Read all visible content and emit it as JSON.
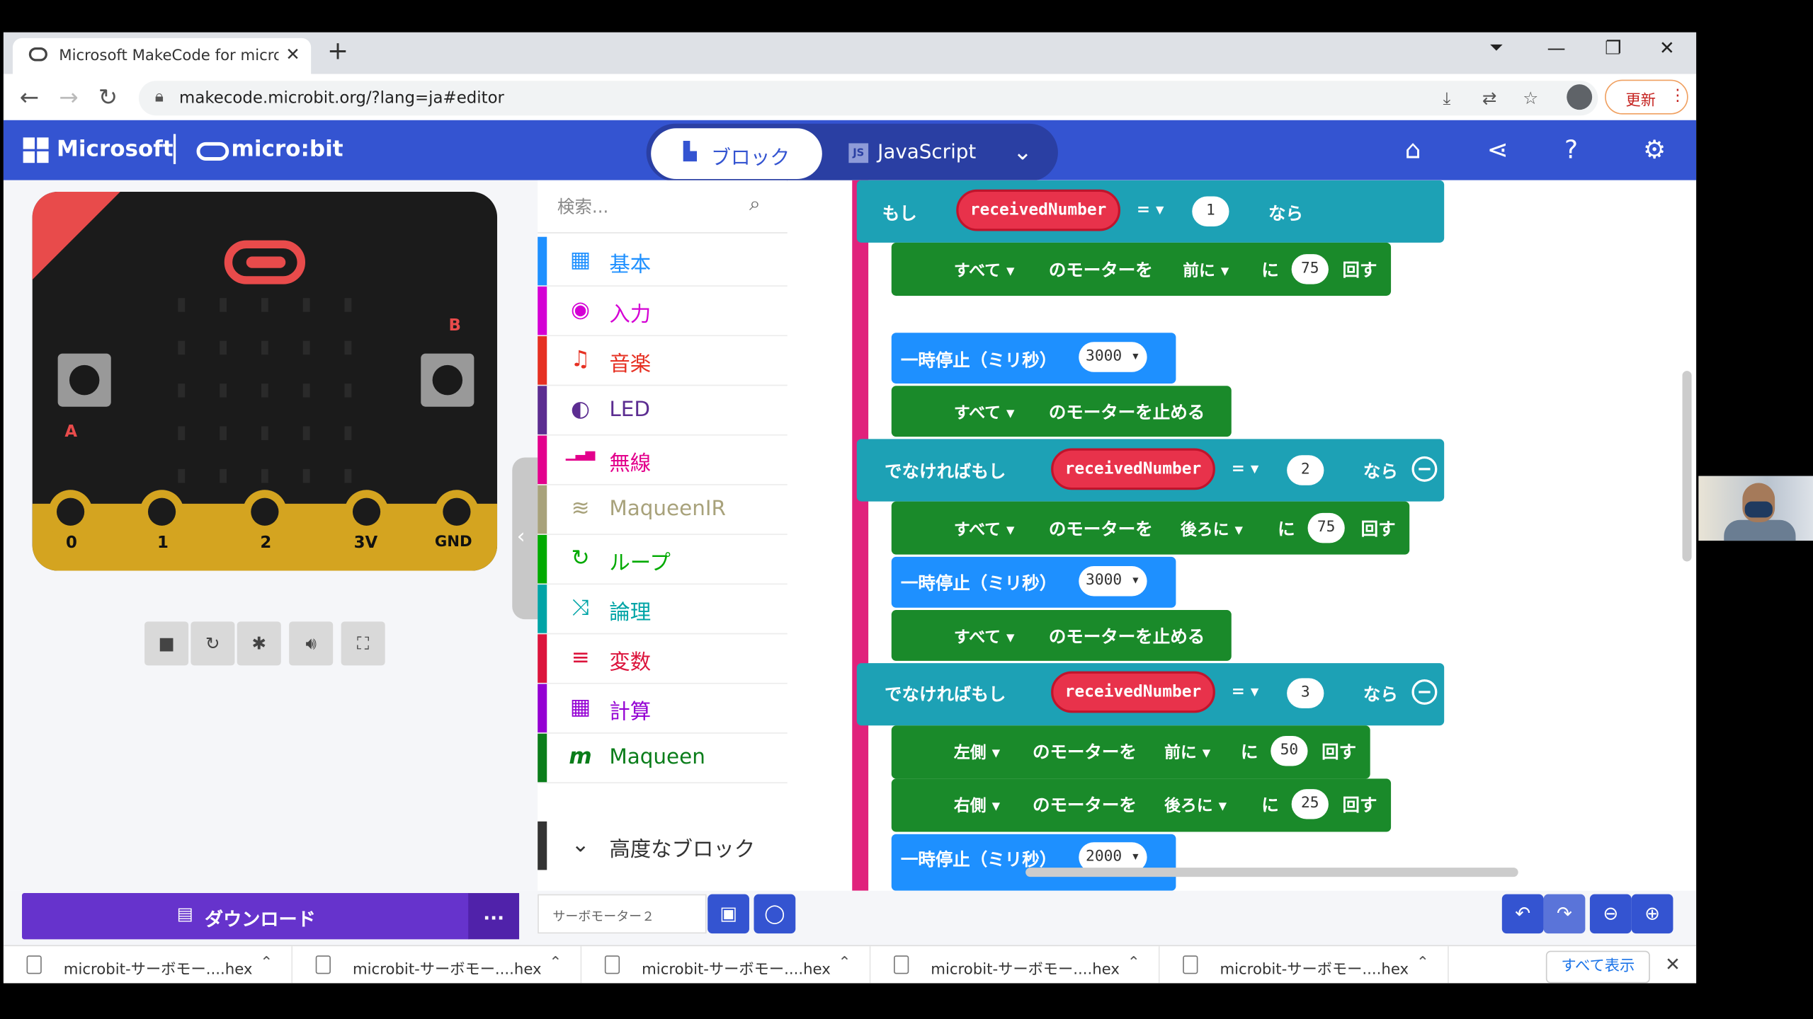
{
  "browser": {
    "tab_title": "Microsoft MakeCode for micro:b",
    "tab_close": "✕",
    "new_tab": "+",
    "url": "makecode.microbit.org/?lang=ja#editor",
    "update_label": "更新"
  },
  "header": {
    "brand": "Microsoft",
    "product": "micro:bit",
    "blocks_label": "ブロック",
    "js_label": "JavaScript"
  },
  "simulator": {
    "button_a": "A",
    "button_b": "B",
    "pins": [
      "0",
      "1",
      "2",
      "3V",
      "GND"
    ]
  },
  "toolbox": {
    "search_placeholder": "検索...",
    "categories": [
      {
        "label": "基本",
        "color": "#1e90ff",
        "icon": "grid-icon"
      },
      {
        "label": "入力",
        "color": "#d400d4",
        "icon": "target-icon"
      },
      {
        "label": "音楽",
        "color": "#e63022",
        "icon": "headphones-icon"
      },
      {
        "label": "LED",
        "color": "#5c2d91",
        "icon": "toggle-icon"
      },
      {
        "label": "無線",
        "color": "#e3008c",
        "icon": "signal-icon"
      },
      {
        "label": "MaqueenIR",
        "color": "#a8a27b",
        "icon": "wifi-icon"
      },
      {
        "label": "ループ",
        "color": "#00aa00",
        "icon": "loop-icon"
      },
      {
        "label": "論理",
        "color": "#00a4a6",
        "icon": "shuffle-icon"
      },
      {
        "label": "変数",
        "color": "#dc143c",
        "icon": "lines-icon"
      },
      {
        "label": "計算",
        "color": "#9400d3",
        "icon": "calculator-icon"
      },
      {
        "label": "Maqueen",
        "color": "#0a7d1a",
        "icon": "maqueen-icon"
      }
    ],
    "advanced_label": "高度なブロック"
  },
  "workspace": {
    "if_label": "もし",
    "elseif_label": "でなければもし",
    "then_label": "なら",
    "var_name": "receivedNumber",
    "eq_op": "= ▾",
    "all_label": "すべて ▾",
    "motor_label": "のモーターを",
    "ni_label": "に",
    "turn_label": "回す",
    "stop_label": "のモーターを止める",
    "pause_label": "一時停止（ミリ秒）",
    "forward_label": "前に ▾",
    "backward_label": "後ろに ▾",
    "left_label": "左側 ▾",
    "right_label": "右側 ▾",
    "if_values": [
      "1",
      "2",
      "3"
    ],
    "speeds": [
      "75",
      "75",
      "50",
      "25"
    ],
    "pauses": [
      "3000 ▾",
      "3000 ▾",
      "2000 ▾"
    ]
  },
  "bottom": {
    "download_label": "ダウンロード",
    "more_label": "...",
    "project_name": "サーボモーター２"
  },
  "downloads": {
    "files": [
      "microbit-サーボモー....hex",
      "microbit-サーボモー....hex",
      "microbit-サーボモー....hex",
      "microbit-サーボモー....hex",
      "microbit-サーボモー....hex"
    ],
    "show_all": "すべて表示"
  }
}
